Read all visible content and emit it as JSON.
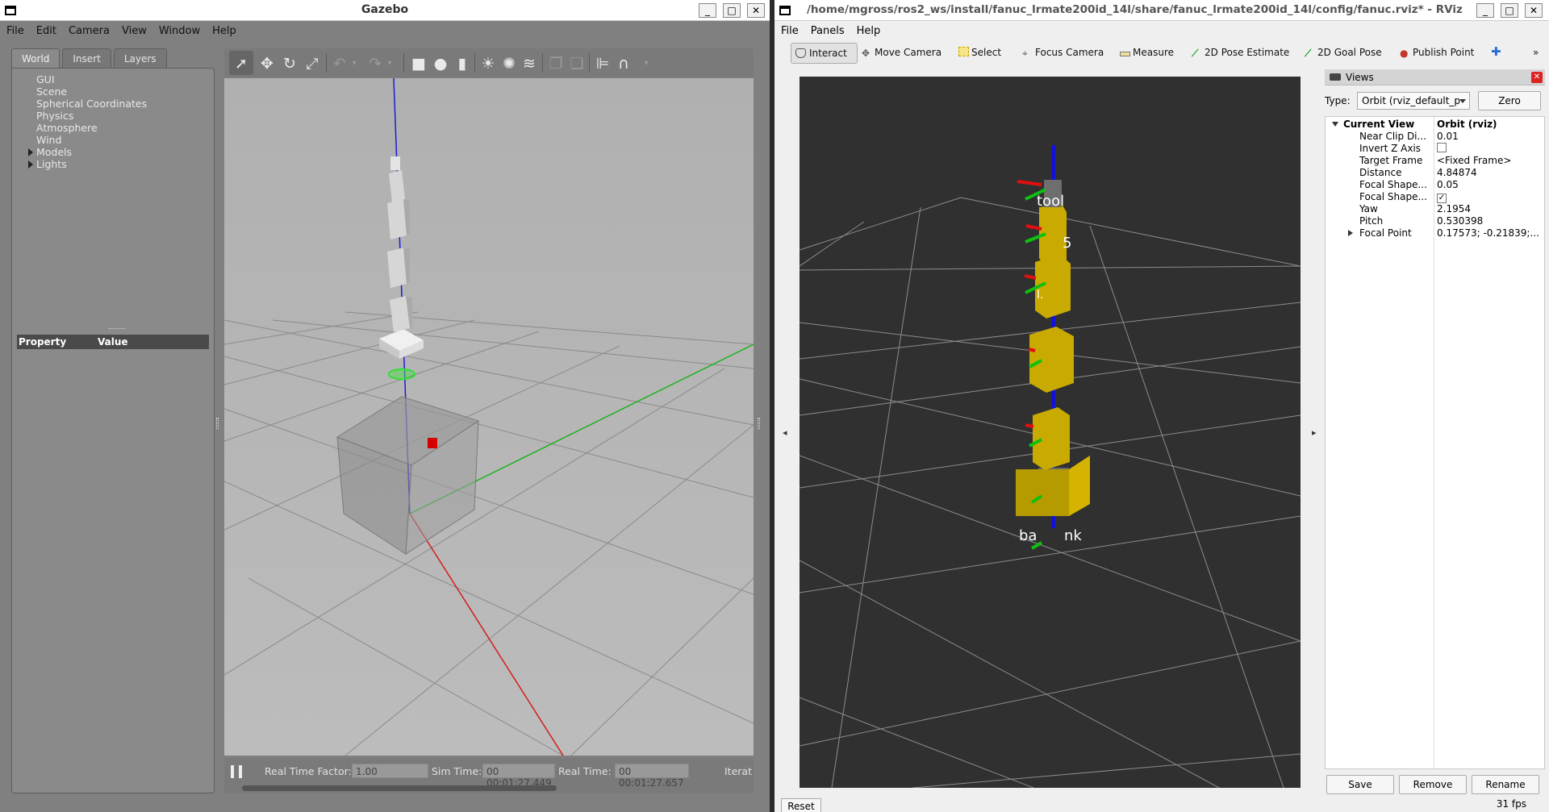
{
  "gazebo": {
    "title": "Gazebo",
    "menu": [
      "File",
      "Edit",
      "Camera",
      "View",
      "Window",
      "Help"
    ],
    "tabs": [
      "World",
      "Insert",
      "Layers"
    ],
    "tree": [
      "GUI",
      "Scene",
      "Spherical Coordinates",
      "Physics",
      "Atmosphere",
      "Wind",
      "Models",
      "Lights"
    ],
    "property_header": {
      "property": "Property",
      "value": "Value"
    },
    "status": {
      "rtf_label": "Real Time Factor:",
      "rtf_value": "1.00",
      "sim_label": "Sim Time:",
      "sim_value": "00 00:01:27.449",
      "real_label": "Real Time:",
      "real_value": "00 00:01:27.657",
      "iter_label": "Iterat"
    }
  },
  "rviz": {
    "title": "/home/mgross/ros2_ws/install/fanuc_lrmate200id_14l/share/fanuc_lrmate200id_14l/config/fanuc.rviz* - RViz",
    "menu": [
      "File",
      "Panels",
      "Help"
    ],
    "tools": [
      "Interact",
      "Move Camera",
      "Select",
      "Focus Camera",
      "Measure",
      "2D Pose Estimate",
      "2D Goal Pose",
      "Publish Point"
    ],
    "views": {
      "title": "Views",
      "type_label": "Type:",
      "type_value": "Orbit (rviz_default_p",
      "zero": "Zero",
      "current_view": {
        "label": "Current View",
        "value": "Orbit (rviz)"
      },
      "props": [
        {
          "k": "Near Clip Di...",
          "v": "0.01"
        },
        {
          "k": "Invert Z Axis",
          "v": ""
        },
        {
          "k": "Target Frame",
          "v": "<Fixed Frame>"
        },
        {
          "k": "Distance",
          "v": "4.84874"
        },
        {
          "k": "Focal Shape...",
          "v": "0.05"
        },
        {
          "k": "Focal Shape...",
          "v": ""
        },
        {
          "k": "Yaw",
          "v": "2.1954"
        },
        {
          "k": "Pitch",
          "v": "0.530398"
        },
        {
          "k": "Focal Point",
          "v": "0.17573; -0.21839;..."
        }
      ],
      "buttons": [
        "Save",
        "Remove",
        "Rename"
      ]
    },
    "scene_labels": {
      "tool": "tool",
      "l5": "5",
      "l4": "l.",
      "base": "ba",
      "base2": "nk"
    },
    "reset": "Reset",
    "fps": "31 fps"
  }
}
